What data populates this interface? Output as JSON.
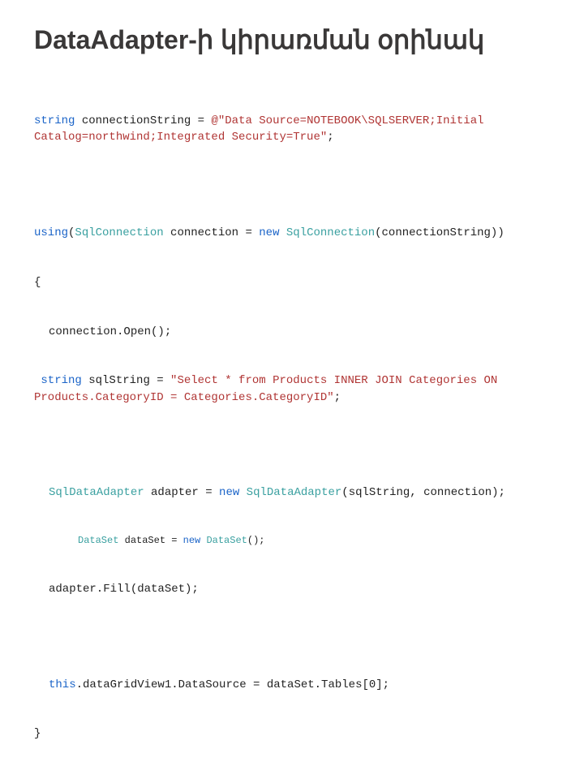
{
  "title": "DataAdapter-ի կիրառման օրինակ",
  "code": {
    "l1_kw": "string",
    "l1_txt": " connectionString = ",
    "l1_at": "@\"Data Source=NOTEBOOK\\SQLSERVER;Initial Catalog=northwind;Integrated Security=True\"",
    "l1_end": ";",
    "l3_kw1": "using",
    "l3_p1": "(",
    "l3_type1": "SqlConnection",
    "l3_txt1": " connection = ",
    "l3_kw2": "new",
    "l3_sp": " ",
    "l3_type2": "SqlConnection",
    "l3_txt2": "(connectionString))",
    "l4": "{",
    "l5": "connection.Open();",
    "l6_kw": "string",
    "l6_txt": " sqlString = ",
    "l6_str": "\"Select * from Products INNER JOIN Categories ON Products.CategoryID = Categories.CategoryID\"",
    "l6_end": ";",
    "l8_type1": "SqlDataAdapter",
    "l8_txt1": " adapter = ",
    "l8_kw": "new",
    "l8_sp": " ",
    "l8_type2": "SqlDataAdapter",
    "l8_txt2": "(sqlString, connection);",
    "l9_type1": "DataSet",
    "l9_txt1": " dataSet = ",
    "l9_kw": "new",
    "l9_sp": " ",
    "l9_type2": "DataSet",
    "l9_txt2": "();",
    "l10": "adapter.Fill(dataSet);",
    "l12_kw": "this",
    "l12_txt": ".dataGridView1.DataSource = dataSet.Tables[0];",
    "l13": "}"
  }
}
